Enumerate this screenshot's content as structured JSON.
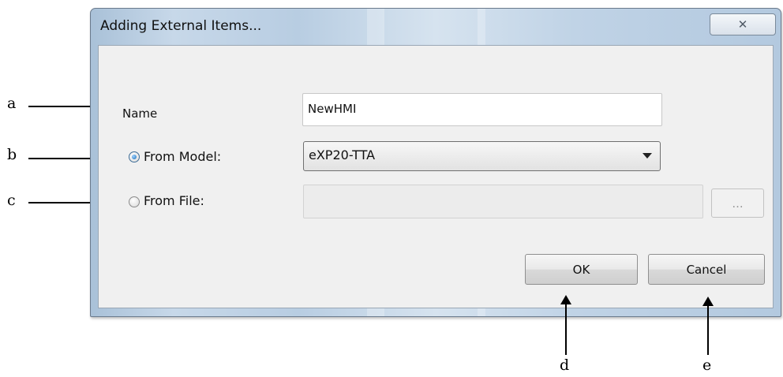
{
  "dialog": {
    "title": "Adding External Items...",
    "close_icon": "close-x-icon",
    "close_glyph": "✕"
  },
  "form": {
    "name_label": "Name",
    "name_value": "NewHMI",
    "from_model_label": "From Model:",
    "from_model_selected": true,
    "model_value": "eXP20-TTA",
    "from_file_label": "From File:",
    "from_file_selected": false,
    "file_value": "",
    "browse_label": "..."
  },
  "buttons": {
    "ok_label": "OK",
    "cancel_label": "Cancel"
  },
  "annotations": {
    "a": "a",
    "b": "b",
    "c": "c",
    "d": "d",
    "e": "e"
  }
}
